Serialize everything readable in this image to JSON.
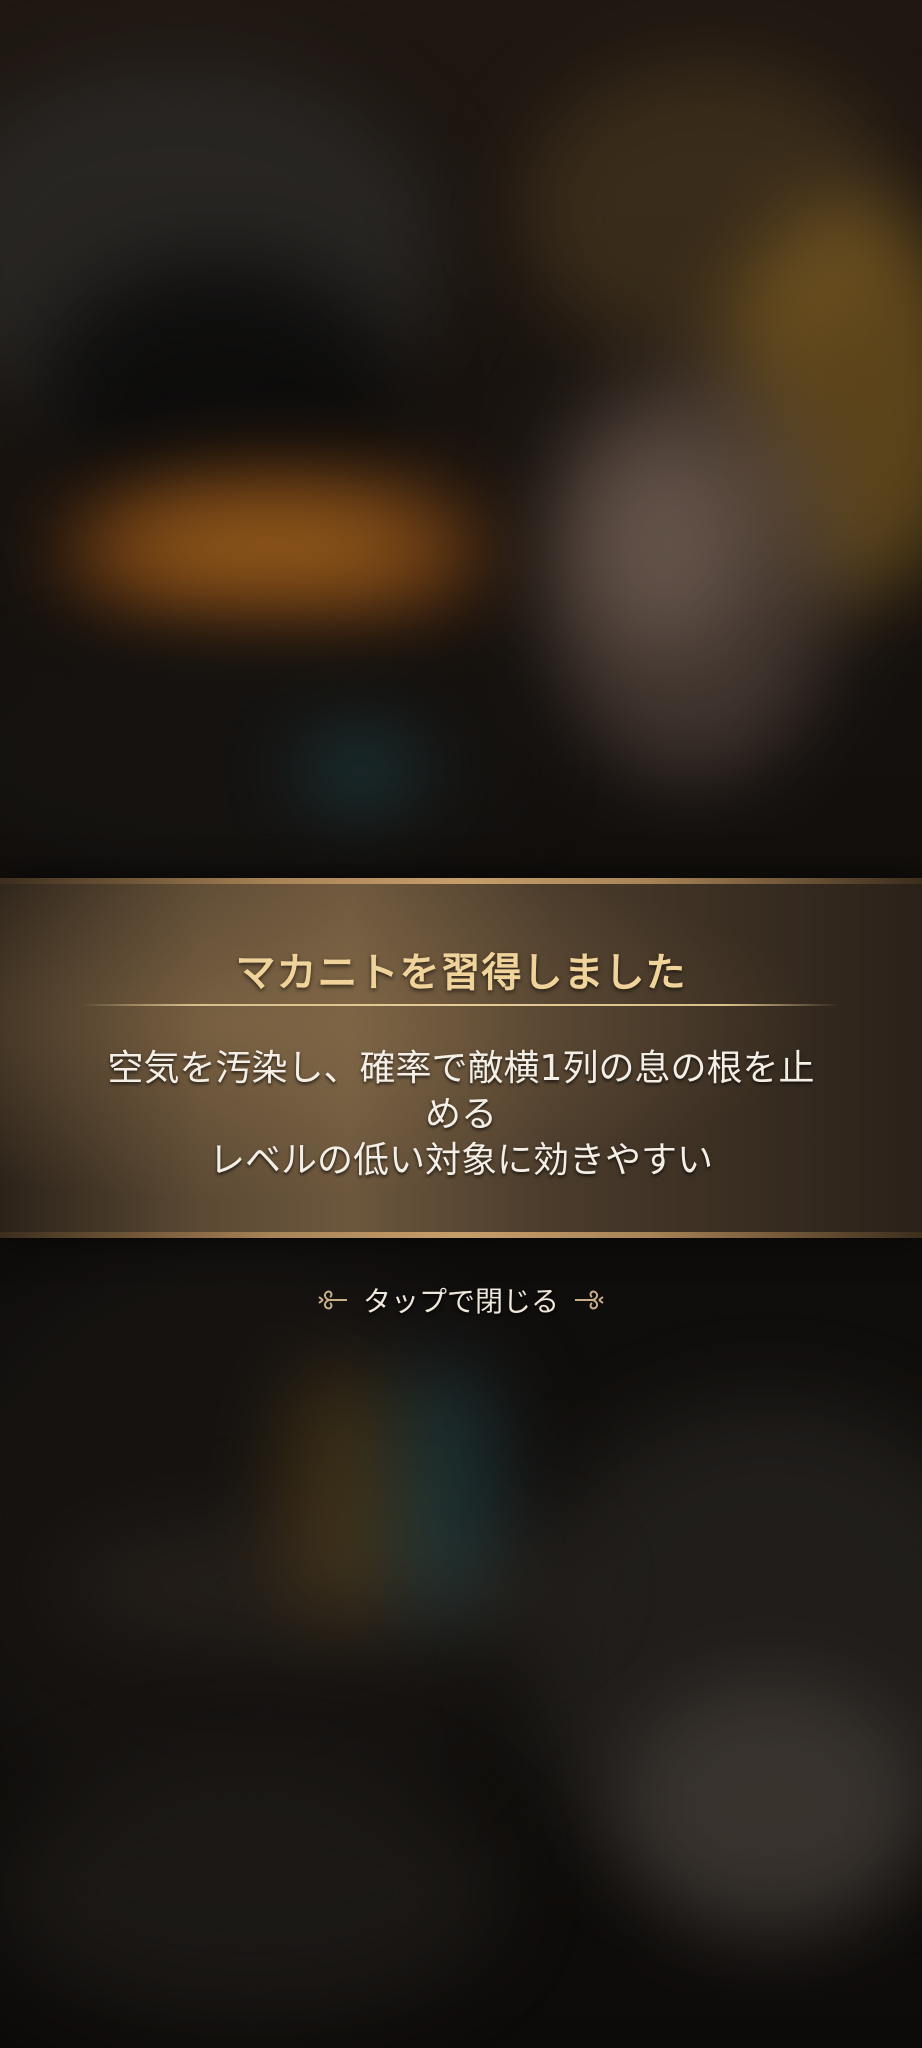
{
  "notification": {
    "title": "マカニトを習得しました",
    "description_lines": [
      "空気を汚染し、確率で敵横1列の息の根を止",
      "める",
      "レベルの低い対象に効きやすい"
    ]
  },
  "tap_to_close": {
    "label": "タップで閉じる",
    "left_ornament_icon": "scroll-ornament-left-icon",
    "right_ornament_icon": "scroll-ornament-right-icon"
  },
  "colors": {
    "title_gold": "#f0d39a",
    "body_text": "#f4efe6",
    "banner_edge": "#c59e6a"
  }
}
